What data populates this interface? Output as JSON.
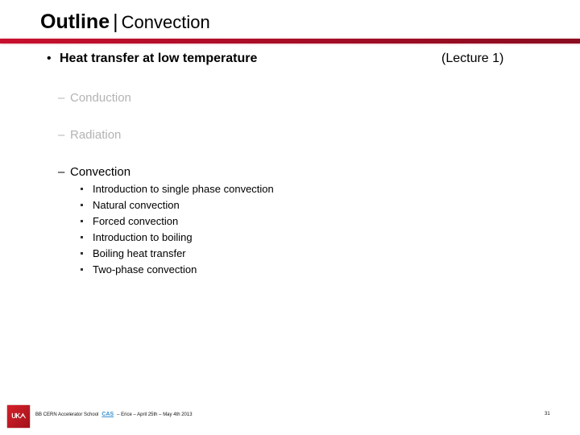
{
  "slide": {
    "title_main": "Outline",
    "title_separator": "|",
    "title_sub": "Convection",
    "colors": {
      "accent_rule": "#c8102e",
      "dimmed_text": "#b3b3b3",
      "cas_logo_blue": "#3a8fd0"
    }
  },
  "content": {
    "level1": {
      "bullet": "•",
      "text": "Heat transfer at low temperature",
      "note": "(Lecture 1)"
    },
    "level2": [
      {
        "dash": "–",
        "text": "Conduction",
        "state": "dimmed"
      },
      {
        "dash": "–",
        "text": "Radiation",
        "state": "dimmed"
      },
      {
        "dash": "–",
        "text": "Convection",
        "state": "active"
      }
    ],
    "level3": [
      "Introduction to single phase convection",
      "Natural convection",
      "Forced convection",
      "Introduction to boiling",
      "Boiling heat transfer",
      "Two-phase convection"
    ]
  },
  "footer": {
    "org_logo_text": "ᑌᏦᗅ",
    "org_logo_icon": "institution-logo",
    "school_prefix": "BB  CERN Accelerator School",
    "cas_logo_text": "CAS",
    "event_text": "– Erice – April 25th – May 4th 2013",
    "page_number": "31"
  }
}
